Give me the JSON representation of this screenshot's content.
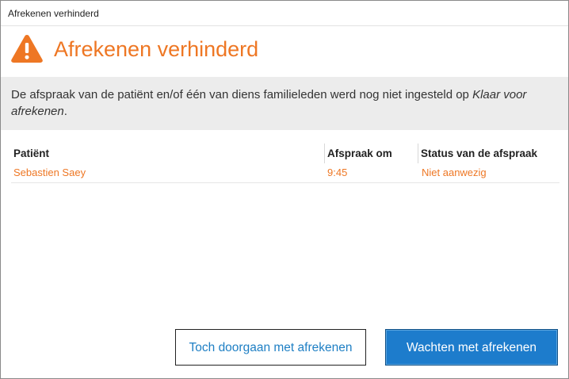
{
  "window": {
    "title": "Afrekenen verhinderd"
  },
  "header": {
    "icon": "warning-icon",
    "title": "Afrekenen verhinderd",
    "accent_color": "#ee7724"
  },
  "message": {
    "text_plain": "De afspraak van de patiënt en/of één van diens familieleden werd nog niet ingesteld op ",
    "text_emphasis": "Klaar voor afrekenen",
    "text_end": "."
  },
  "table": {
    "columns": [
      "Patiënt",
      "Afspraak om",
      "Status van de afspraak"
    ],
    "rows": [
      {
        "patient": "Sebastien Saey",
        "time": "9:45",
        "status": "Niet aanwezig"
      }
    ]
  },
  "buttons": {
    "continue_label": "Toch doorgaan met afrekenen",
    "wait_label": "Wachten met afrekenen",
    "primary_color": "#1d7ccc"
  }
}
